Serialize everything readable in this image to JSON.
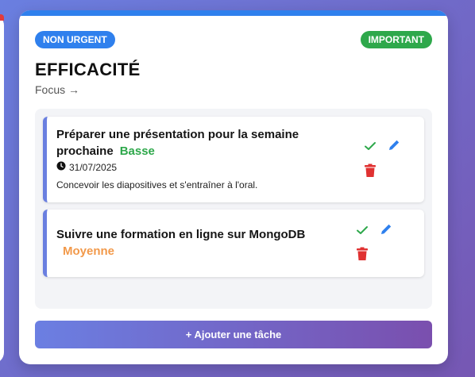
{
  "card": {
    "badge_left": "NON URGENT",
    "badge_right": "IMPORTANT",
    "title": "EFFICACITÉ",
    "subtitle": "Focus →"
  },
  "tasks": [
    {
      "title": "Préparer une présentation pour la semaine prochaine",
      "priority": "Basse",
      "priority_color": "#2ea84b",
      "date": "31/07/2025",
      "description": "Concevoir les diapositives et s'entraîner à l'oral."
    },
    {
      "title": "Suivre une formation en ligne sur MongoDB",
      "priority": "Moyenne",
      "priority_color": "#f2994a"
    }
  ],
  "add_button": "+ Ajouter une tâche",
  "icons": [
    "check-icon",
    "edit-icon",
    "trash-icon",
    "clock-icon"
  ],
  "colors": {
    "accent_blue": "#2f80ed",
    "important_green": "#2ea84b",
    "delete_red": "#e03131",
    "gradient_start": "#6b7fe2",
    "gradient_end": "#7a4fae"
  }
}
